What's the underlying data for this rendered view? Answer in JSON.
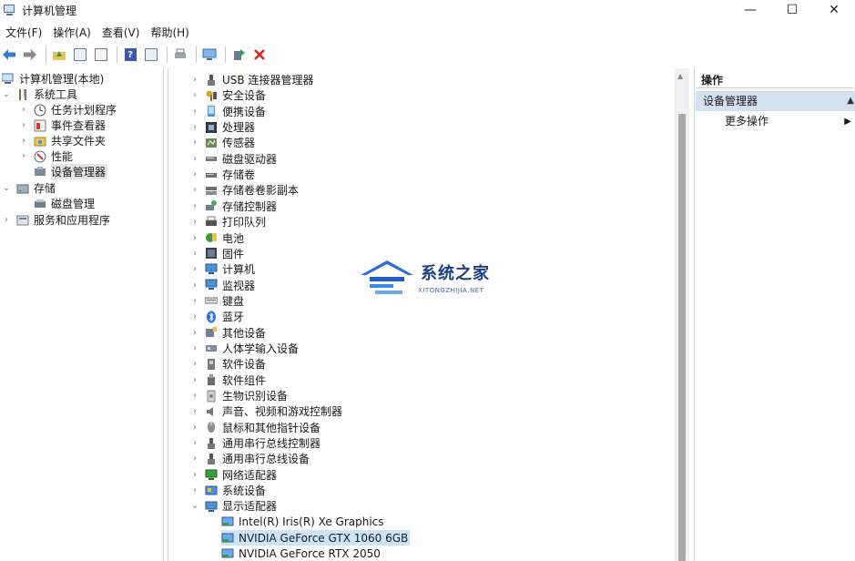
{
  "window": {
    "title": "计算机管理",
    "controls": {
      "minimize": "—",
      "maximize": "☐",
      "close": "✕"
    }
  },
  "menu": [
    "文件(F)",
    "操作(A)",
    "查看(V)",
    "帮助(H)"
  ],
  "toolbar": {
    "icons": [
      "back-arrow-icon",
      "forward-arrow-icon",
      "up-folder-icon",
      "show-tree-icon",
      "properties-icon",
      "help-icon",
      "show-action-pane-icon",
      "print-icon",
      "computer-icon",
      "update-driver-icon",
      "uninstall-icon"
    ]
  },
  "left_tree": {
    "root": "计算机管理(本地)",
    "system_tools": "系统工具",
    "task_scheduler": "任务计划程序",
    "event_viewer": "事件查看器",
    "shared_folders": "共享文件夹",
    "performance": "性能",
    "device_manager": "设备管理器",
    "storage": "存储",
    "disk_management": "磁盘管理",
    "services_apps": "服务和应用程序"
  },
  "devices": [
    {
      "label": "USB 连接器管理器",
      "icon": "usb-icon"
    },
    {
      "label": "安全设备",
      "icon": "security-key-icon"
    },
    {
      "label": "便携设备",
      "icon": "portable-device-icon"
    },
    {
      "label": "处理器",
      "icon": "processor-icon"
    },
    {
      "label": "传感器",
      "icon": "sensor-icon"
    },
    {
      "label": "磁盘驱动器",
      "icon": "disk-drive-icon"
    },
    {
      "label": "存储卷",
      "icon": "storage-volume-icon"
    },
    {
      "label": "存储卷卷影副本",
      "icon": "shadow-copy-icon"
    },
    {
      "label": "存储控制器",
      "icon": "storage-controller-icon"
    },
    {
      "label": "打印队列",
      "icon": "printer-icon"
    },
    {
      "label": "电池",
      "icon": "battery-icon"
    },
    {
      "label": "固件",
      "icon": "firmware-icon"
    },
    {
      "label": "计算机",
      "icon": "computer-icon"
    },
    {
      "label": "监视器",
      "icon": "monitor-icon"
    },
    {
      "label": "键盘",
      "icon": "keyboard-icon"
    },
    {
      "label": "蓝牙",
      "icon": "bluetooth-icon"
    },
    {
      "label": "其他设备",
      "icon": "other-devices-icon"
    },
    {
      "label": "人体学输入设备",
      "icon": "hid-icon"
    },
    {
      "label": "软件设备",
      "icon": "software-device-icon"
    },
    {
      "label": "软件组件",
      "icon": "software-component-icon"
    },
    {
      "label": "生物识别设备",
      "icon": "biometric-icon"
    },
    {
      "label": "声音、视频和游戏控制器",
      "icon": "sound-icon"
    },
    {
      "label": "鼠标和其他指针设备",
      "icon": "mouse-icon"
    },
    {
      "label": "通用串行总线控制器",
      "icon": "usb-controller-icon"
    },
    {
      "label": "通用串行总线设备",
      "icon": "usb-device-icon"
    },
    {
      "label": "网络适配器",
      "icon": "network-adapter-icon"
    },
    {
      "label": "系统设备",
      "icon": "system-device-icon"
    },
    {
      "label": "显示适配器",
      "icon": "display-adapter-icon"
    }
  ],
  "display_adapters": [
    {
      "label": "Intel(R) Iris(R) Xe Graphics"
    },
    {
      "label": "NVIDIA GeForce GTX 1060 6GB"
    },
    {
      "label": "NVIDIA GeForce RTX 2050"
    }
  ],
  "actions": {
    "header": "操作",
    "section": "设备管理器",
    "more": "更多操作"
  },
  "watermark": {
    "name": "系统之家",
    "url": "XITONGZHIJIA.NET"
  },
  "colors": {
    "selection": "#cce4f7",
    "action_section_bg": "#d5e0ee",
    "uninstall_red": "#e0241b",
    "watermark_blue": "#1b3e8c"
  }
}
